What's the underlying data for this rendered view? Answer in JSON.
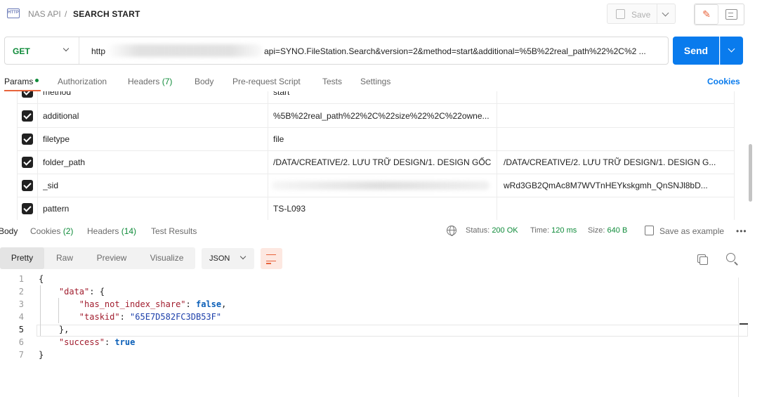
{
  "header": {
    "app_icon_label": "HTTP",
    "breadcrumb_parent": "NAS API",
    "breadcrumb_sep": "/",
    "title": "SEARCH START",
    "save_label": "Save"
  },
  "request": {
    "method": "GET",
    "url_prefix": "http",
    "url_rest": "api=SYNO.FileStation.Search&version=2&method=start&additional=%5B%22real_path%22%2C%2 ...",
    "send_label": "Send"
  },
  "request_tabs": [
    {
      "label": "Params"
    },
    {
      "label": "Authorization"
    },
    {
      "label": "Headers",
      "count": "(7)"
    },
    {
      "label": "Body"
    },
    {
      "label": "Pre-request Script"
    },
    {
      "label": "Tests"
    },
    {
      "label": "Settings"
    }
  ],
  "cookies_link": "Cookies",
  "params": [
    {
      "key": "method",
      "value": "start",
      "description": ""
    },
    {
      "key": "additional",
      "value": "%5B%22real_path%22%2C%22size%22%2C%22owne...",
      "description": ""
    },
    {
      "key": "filetype",
      "value": "file",
      "description": ""
    },
    {
      "key": "folder_path",
      "value": "/DATA/CREATIVE/2. LƯU TRỮ DESIGN/1. DESIGN GỐC",
      "description": "/DATA/CREATIVE/2. LƯU TRỮ DESIGN/1. DESIGN G..."
    },
    {
      "key": "_sid",
      "value": "",
      "description": "wRd3GB2QmAc8M7WVTnHEYkskgmh_QnSNJl8bD..."
    },
    {
      "key": "pattern",
      "value": "TS-L093",
      "description": ""
    }
  ],
  "response_tabs": [
    {
      "label": "Body"
    },
    {
      "label": "Cookies",
      "count": "(2)"
    },
    {
      "label": "Headers",
      "count": "(14)"
    },
    {
      "label": "Test Results"
    }
  ],
  "status": {
    "status_label": "Status:",
    "status_value": "200 OK",
    "time_label": "Time:",
    "time_value": "120 ms",
    "size_label": "Size:",
    "size_value": "640 B",
    "save_example": "Save as example",
    "more": "•••"
  },
  "format_tabs": [
    "Pretty",
    "Raw",
    "Preview",
    "Visualize"
  ],
  "language": "JSON",
  "code_lines": [
    {
      "n": "1",
      "parts": [
        [
          "p",
          "{"
        ]
      ]
    },
    {
      "n": "2",
      "parts": [
        [
          "p",
          "    "
        ],
        [
          "key",
          "\"data\""
        ],
        [
          "p",
          ": {"
        ]
      ]
    },
    {
      "n": "3",
      "parts": [
        [
          "p",
          "        "
        ],
        [
          "key",
          "\"has_not_index_share\""
        ],
        [
          "p",
          ": "
        ],
        [
          "bool",
          "false"
        ],
        [
          "p",
          ","
        ]
      ]
    },
    {
      "n": "4",
      "parts": [
        [
          "p",
          "        "
        ],
        [
          "key",
          "\"taskid\""
        ],
        [
          "p",
          ": "
        ],
        [
          "str",
          "\"65E7D582FC3DB53F\""
        ]
      ]
    },
    {
      "n": "5",
      "parts": [
        [
          "p",
          "    },"
        ]
      ]
    },
    {
      "n": "6",
      "parts": [
        [
          "p",
          "    "
        ],
        [
          "key",
          "\"success\""
        ],
        [
          "p",
          ": "
        ],
        [
          "bool",
          "true"
        ]
      ]
    },
    {
      "n": "7",
      "parts": [
        [
          "p",
          "}"
        ]
      ]
    }
  ],
  "colors": {
    "accent_orange": "#e8643c",
    "send_blue": "#097bed",
    "success_green": "#0f8b3a"
  }
}
